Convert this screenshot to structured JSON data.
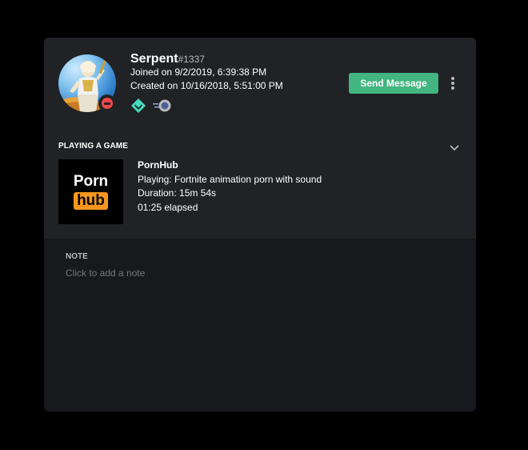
{
  "user": {
    "username": "Serpent",
    "discriminator": "#1337",
    "joined": "Joined on 9/2/2019, 6:39:38 PM",
    "created": "Created on 10/16/2018, 5:51:00 PM",
    "status": "do-not-disturb",
    "badges": [
      "hypesquad-balance-icon",
      "nitro-boost-icon"
    ]
  },
  "actions": {
    "send_message_label": "Send Message"
  },
  "activity": {
    "section_title": "PLAYING A GAME",
    "game_name": "PornHub",
    "playing": "Playing: Fortnite animation porn with sound",
    "duration": "Duration: 15m 54s",
    "elapsed": "01:25 elapsed",
    "logo": {
      "top": "Porn",
      "bottom": "hub"
    }
  },
  "note": {
    "title": "NOTE",
    "placeholder": "Click to add a note"
  },
  "colors": {
    "accent_green": "#43b581",
    "dnd_red": "#f04747",
    "logo_orange": "#f7971d",
    "card_background": "#18191c",
    "header_background": "#202225"
  }
}
